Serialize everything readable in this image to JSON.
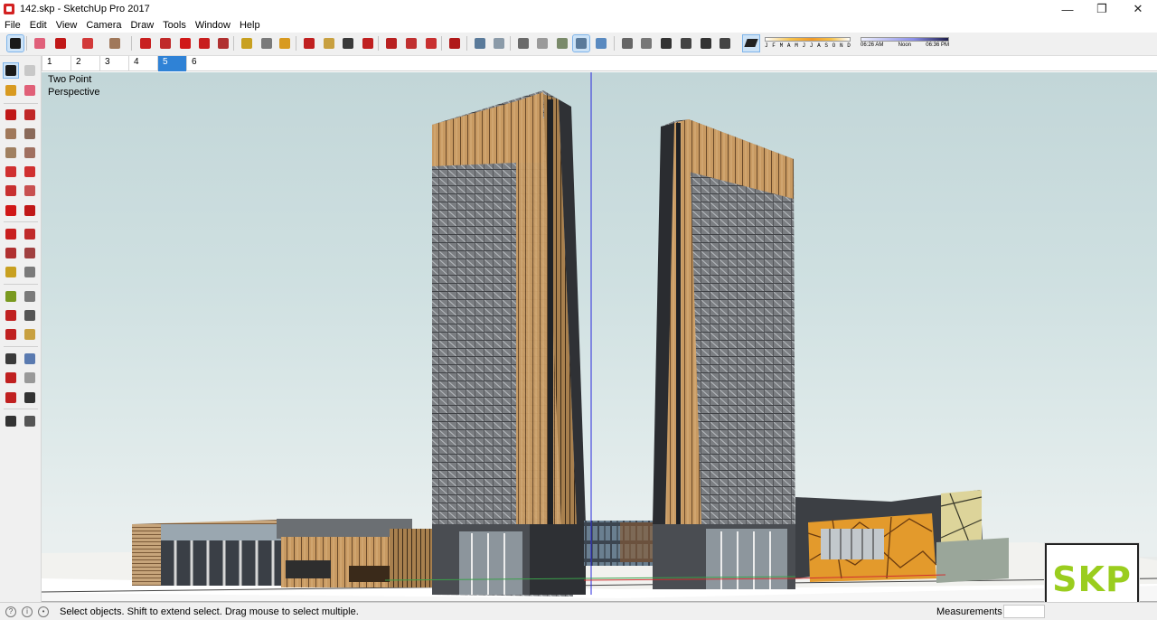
{
  "window": {
    "title": "142.skp - SketchUp Pro 2017",
    "minimize": "—",
    "maximize": "❐",
    "close": "✕"
  },
  "menu": [
    "File",
    "Edit",
    "View",
    "Camera",
    "Draw",
    "Tools",
    "Window",
    "Help"
  ],
  "toolbar": {
    "icons": [
      {
        "name": "select-icon",
        "color": "#1a1a1a",
        "active": true
      },
      {
        "name": "eraser-icon",
        "color": "#e0607a"
      },
      {
        "name": "line-icon",
        "color": "#c01818"
      },
      {
        "name": "arc-icon",
        "color": "#d23a3a"
      },
      {
        "name": "rectangle-icon",
        "color": "#a0785a"
      },
      {
        "name": "push-pull-icon",
        "color": "#c82020"
      },
      {
        "name": "offset-icon",
        "color": "#c02a2a"
      },
      {
        "name": "move-icon",
        "color": "#d01818"
      },
      {
        "name": "rotate-icon",
        "color": "#c81e1e"
      },
      {
        "name": "scale-icon",
        "color": "#b03030"
      },
      {
        "name": "tape-measure-icon",
        "color": "#c8a020"
      },
      {
        "name": "text-icon",
        "color": "#7a7a7a"
      },
      {
        "name": "paint-bucket-icon",
        "color": "#d89a20"
      },
      {
        "name": "orbit-icon",
        "color": "#c02020"
      },
      {
        "name": "pan-icon",
        "color": "#c8a040"
      },
      {
        "name": "zoom-icon",
        "color": "#3a3a3a"
      },
      {
        "name": "zoom-extents-icon",
        "color": "#c02020"
      },
      {
        "name": "warehouse-icon",
        "color": "#b82020"
      },
      {
        "name": "extension-warehouse-icon",
        "color": "#c03030"
      },
      {
        "name": "layout-icon",
        "color": "#c83030"
      },
      {
        "name": "ruby-icon",
        "color": "#b01818"
      },
      {
        "name": "xray-icon",
        "color": "#5a7a9a"
      },
      {
        "name": "back-edges-icon",
        "color": "#8a9aa8"
      },
      {
        "name": "wireframe-icon",
        "color": "#6a6a6a"
      },
      {
        "name": "hidden-line-icon",
        "color": "#9a9a9a"
      },
      {
        "name": "shaded-icon",
        "color": "#7a8a6a"
      },
      {
        "name": "shaded-textures-icon",
        "color": "#5a7a9a",
        "active": true
      },
      {
        "name": "monochrome-icon",
        "color": "#5a8ac0"
      },
      {
        "name": "iso-view-icon",
        "color": "#666666"
      },
      {
        "name": "top-view-icon",
        "color": "#777777"
      },
      {
        "name": "front-view-icon",
        "color": "#333333"
      },
      {
        "name": "right-view-icon",
        "color": "#444444"
      },
      {
        "name": "back-view-icon",
        "color": "#333333"
      },
      {
        "name": "left-view-icon",
        "color": "#444444"
      }
    ]
  },
  "shadows": {
    "months": [
      "J",
      "F",
      "M",
      "A",
      "M",
      "J",
      "J",
      "A",
      "S",
      "O",
      "N",
      "D"
    ],
    "time_start": "06:26 AM",
    "time_mid": "Noon",
    "time_end": "06:36 PM"
  },
  "scenes": {
    "tabs": [
      "1",
      "2",
      "3",
      "4",
      "5",
      "6"
    ],
    "active_index": 4
  },
  "left_toolbar": {
    "icons": [
      "select-icon",
      "make-component-icon",
      "paint-bucket-icon",
      "eraser-icon",
      "line-icon",
      "freehand-icon",
      "rectangle-icon",
      "rotated-rectangle-icon",
      "circle-icon",
      "polygon-icon",
      "arc-icon",
      "two-point-arc-icon",
      "three-point-arc-icon",
      "pie-icon",
      "move-icon",
      "push-pull-icon",
      "rotate-icon",
      "follow-me-icon",
      "scale-icon",
      "offset-icon",
      "tape-measure-icon",
      "dimension-icon",
      "protractor-icon",
      "text-icon",
      "axes-icon",
      "3d-text-icon",
      "orbit-icon",
      "pan-icon",
      "zoom-icon",
      "zoom-window-icon",
      "zoom-extents-icon",
      "previous-view-icon",
      "position-camera-icon",
      "look-around-icon",
      "walk-icon",
      "section-plane-icon"
    ]
  },
  "viewport": {
    "camera_label": "Two Point Perspective"
  },
  "statusbar": {
    "hint": "Select objects. Shift to extend select. Drag mouse to select multiple.",
    "measurements_label": "Measurements",
    "measurements_value": ""
  },
  "watermark": {
    "text": "SKP"
  }
}
